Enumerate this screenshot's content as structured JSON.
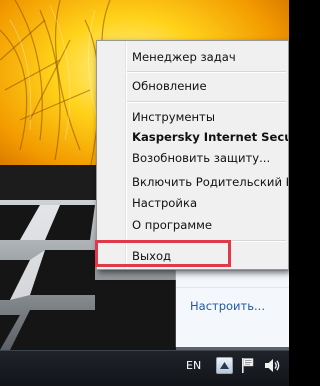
{
  "context_menu": {
    "items": [
      {
        "label": "Менеджер задач",
        "bold": false
      },
      {
        "label": "Обновление",
        "bold": false
      },
      {
        "label": "Инструменты",
        "bold": false
      },
      {
        "label": "Kaspersky Internet Security",
        "bold": true
      },
      {
        "label": "Возобновить защиту...",
        "bold": false
      },
      {
        "label": "Включить Родительский Контроль",
        "bold": false
      },
      {
        "label": "Настройка",
        "bold": false
      },
      {
        "label": "О программе",
        "bold": false
      },
      {
        "label": "Выход",
        "bold": false,
        "highlighted": true
      }
    ]
  },
  "notification_flyout": {
    "customize_link": "Настроить..."
  },
  "taskbar": {
    "language": "EN",
    "icons": [
      "show-hidden-icons-arrow",
      "action-center-flag-icon",
      "volume-icon"
    ]
  },
  "colors": {
    "highlight_border": "#e03a4a",
    "link": "#1e5aa8",
    "menu_background": "#f0f0f0"
  }
}
